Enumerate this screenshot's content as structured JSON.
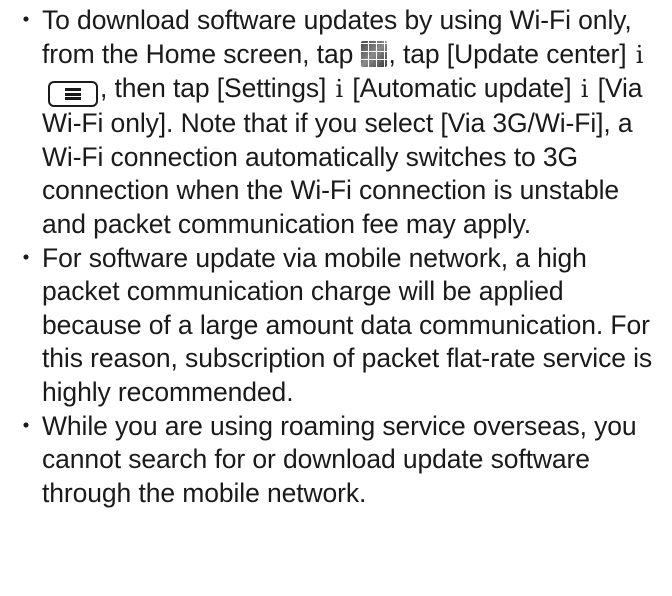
{
  "notes": {
    "bullet_glyph": "・",
    "separator": "i",
    "item1": {
      "t1": "To download software updates by using Wi-Fi only, from the Home screen, tap",
      "icon_apps": "apps-grid-icon",
      "t2": ", tap [Update center]",
      "icon_menu": "menu-key-icon",
      "t3": ", then tap [Settings]",
      "t4": "[Automatic update]",
      "t5": "[Via Wi-Fi only]. Note that if you select [Via 3G/Wi-Fi], a Wi-Fi connection automatically switches to 3G connection when the Wi-Fi connection is unstable and packet communication fee may apply."
    },
    "item2": "For software update via mobile network, a high packet communication charge will be applied because of a large amount data communication. For this reason, subscription of packet flat-rate service is highly recommended.",
    "item3": "While you are using roaming service overseas, you cannot search for or download update software through the mobile network."
  }
}
